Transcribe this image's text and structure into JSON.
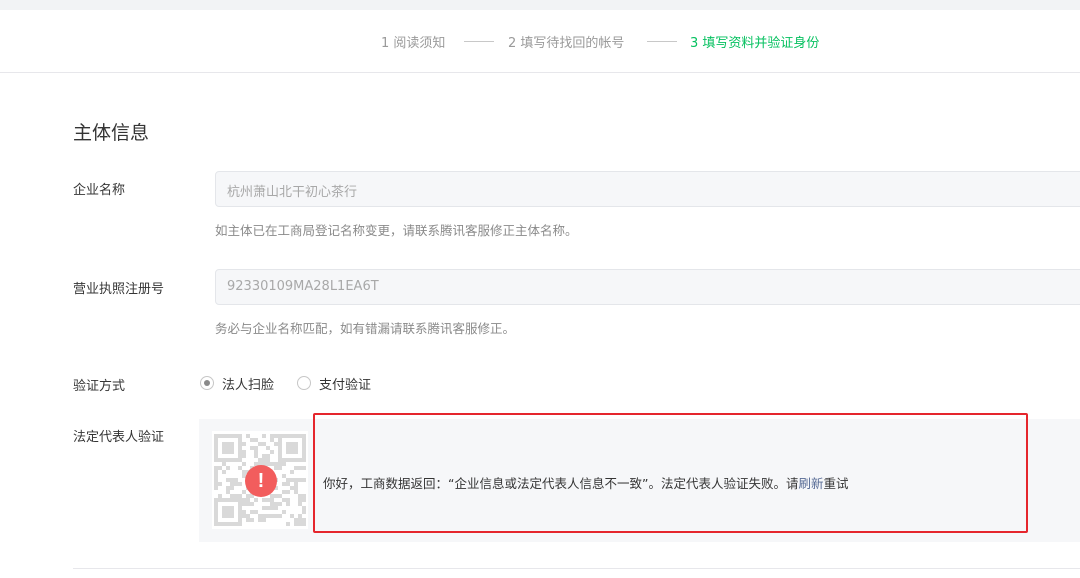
{
  "steps": [
    {
      "label": "1 阅读须知"
    },
    {
      "label": "2 填写待找回的帐号"
    },
    {
      "label": "3 填写资料并验证身份"
    }
  ],
  "section": {
    "title": "主体信息"
  },
  "company": {
    "label": "企业名称",
    "value": "杭州萧山北干初心茶行",
    "hint": "如主体已在工商局登记名称变更，请联系腾讯客服修正主体名称。"
  },
  "license": {
    "label": "营业执照注册号",
    "value": "92330109MA28L1EA6T",
    "hint": "务必与企业名称匹配，如有错漏请联系腾讯客服修正。"
  },
  "verify_method": {
    "label": "验证方式",
    "options": [
      {
        "label": "法人扫脸",
        "checked": true
      },
      {
        "label": "支付验证",
        "checked": false
      }
    ]
  },
  "legal_rep": {
    "label": "法定代表人验证",
    "error_icon": "!",
    "message_prefix": "你好，工商数据返回：“企业信息或法定代表人信息不一致”。法定代表人验证失败。请",
    "message_link": "刷新",
    "message_suffix": "重试"
  },
  "colors": {
    "active_step": "#07c160",
    "error": "#f25d5d",
    "link": "#576b95",
    "highlight_frame": "#e5262d"
  }
}
